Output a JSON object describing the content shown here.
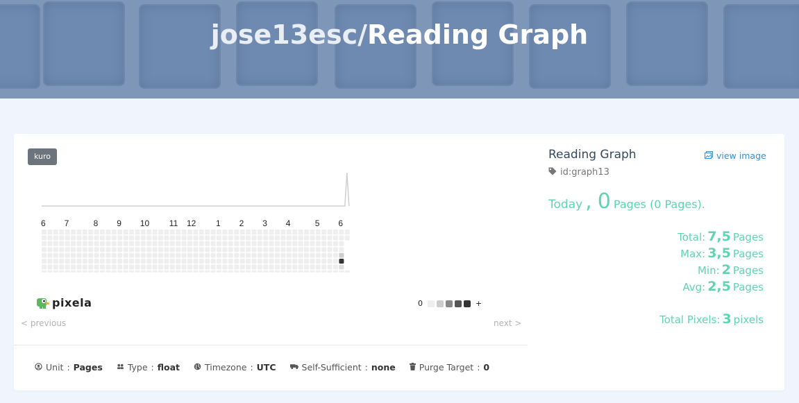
{
  "header": {
    "user": "jose13esc/",
    "graph_name": "Reading Graph"
  },
  "graph": {
    "theme": "kuro",
    "month_labels": [
      "6",
      "7",
      "8",
      "9",
      "10",
      "11",
      "12",
      "1",
      "2",
      "3",
      "4",
      "5",
      "6"
    ],
    "pixels": [
      {
        "week_index": 51,
        "weekday": 4,
        "level": 2
      },
      {
        "week_index": 51,
        "weekday": 5,
        "level": 4
      },
      {
        "week_index": 51,
        "weekday": 6,
        "level": 1
      }
    ],
    "colors": {
      "empty": "#eeeeee",
      "level1": "#dddddd",
      "level2": "#cccccc",
      "level3": "#888888",
      "level4": "#333333",
      "line": "#cfcfcf",
      "spike": "#888888"
    },
    "legend": {
      "min": "0",
      "max": "+",
      "swatches": [
        "#eeeeee",
        "#cccccc",
        "#888888",
        "#555555",
        "#333333"
      ]
    },
    "logo": "pixela",
    "pager": {
      "previous": "< previous",
      "next": "next >"
    }
  },
  "meta": {
    "unit": {
      "label": "Unit",
      "value": "Pages",
      "icon": "user-circle-icon"
    },
    "type": {
      "label": "Type",
      "value": "float",
      "icon": "users-icon"
    },
    "timezone": {
      "label": "Timezone",
      "value": "UTC",
      "icon": "globe-icon"
    },
    "self_sufficient": {
      "label": "Self-Sufficient",
      "value": "none",
      "icon": "truck-icon"
    },
    "purge_target": {
      "label": "Purge Target",
      "value": "0",
      "icon": "trash-icon"
    }
  },
  "info": {
    "title": "Reading Graph",
    "view_image": "view image",
    "id": "id:graph13",
    "today_label": "Today",
    "today_comma": ",",
    "today_value": "0",
    "today_unit": "Pages (0 Pages).",
    "stats": [
      {
        "label": "Total:",
        "value": "7,5",
        "unit": "Pages"
      },
      {
        "label": "Max:",
        "value": "3,5",
        "unit": "Pages"
      },
      {
        "label": "Min:",
        "value": "2",
        "unit": "Pages"
      },
      {
        "label": "Avg:",
        "value": "2,5",
        "unit": "Pages"
      }
    ],
    "total_pixels": {
      "label": "Total Pixels:",
      "value": "3",
      "unit": "pixels"
    }
  }
}
